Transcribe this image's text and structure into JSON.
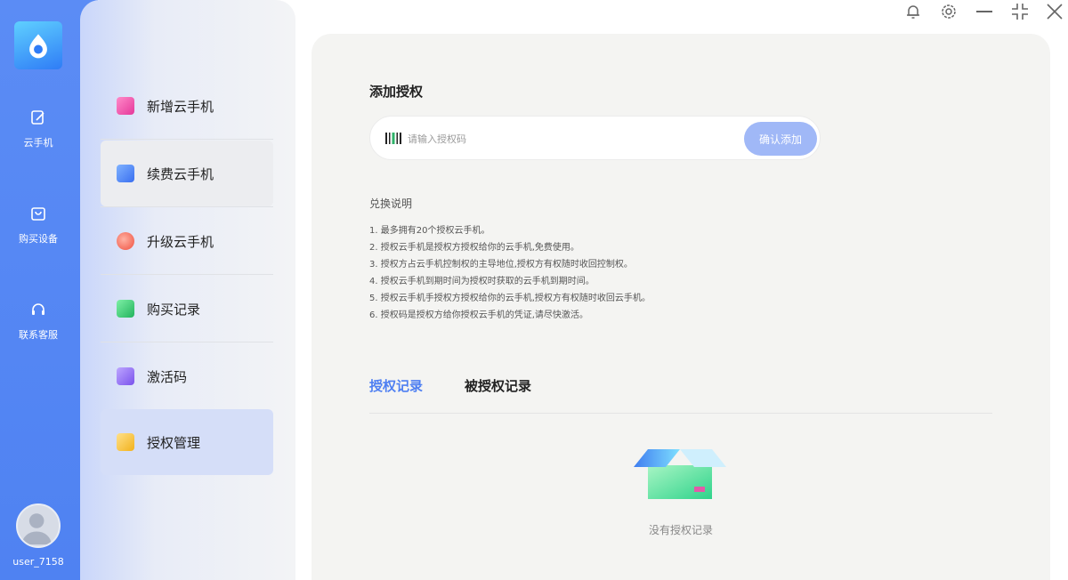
{
  "rail": {
    "items": [
      {
        "label": "云手机",
        "icon": "edit-phone-icon"
      },
      {
        "label": "购买设备",
        "icon": "shopping-bag-icon"
      },
      {
        "label": "联系客服",
        "icon": "headset-icon"
      }
    ],
    "username": "user_7158"
  },
  "menu": {
    "items": [
      {
        "label": "新增云手机",
        "icon": "add-phone-icon",
        "color": "#f05aa6"
      },
      {
        "label": "续费云手机",
        "icon": "renew-card-icon",
        "color": "#4f82f2"
      },
      {
        "label": "升级云手机",
        "icon": "upgrade-rocket-icon",
        "color": "#f5645a"
      },
      {
        "label": "购买记录",
        "icon": "purchase-record-icon",
        "color": "#34c26b"
      },
      {
        "label": "激活码",
        "icon": "activation-code-icon",
        "color": "#8b63f0"
      },
      {
        "label": "授权管理",
        "icon": "folder-icon",
        "color": "#f5c03a"
      }
    ],
    "active_index": 5
  },
  "add_auth": {
    "title": "添加授权",
    "placeholder": "请输入授权码",
    "value": "",
    "button": "确认添加"
  },
  "rules": {
    "title": "兑换说明",
    "items": [
      "1. 最多拥有20个授权云手机。",
      "2. 授权云手机是授权方授权给你的云手机,免费使用。",
      "3. 授权方占云手机控制权的主导地位,授权方有权随时收回控制权。",
      "4. 授权云手机到期时间为授权时获取的云手机到期时间。",
      "5. 授权云手机手授权方授权给你的云手机,授权方有权随时收回云手机。",
      "6. 授权码是授权方给你授权云手机的凭证,请尽快激活。"
    ]
  },
  "tabs": [
    {
      "label": "授权记录",
      "active": true
    },
    {
      "label": "被授权记录",
      "active": false
    }
  ],
  "empty_text": "没有授权记录",
  "colors": {
    "accent": "#4e7ff2",
    "rail": "#5b8cf5",
    "button": "#a0b8f7"
  }
}
